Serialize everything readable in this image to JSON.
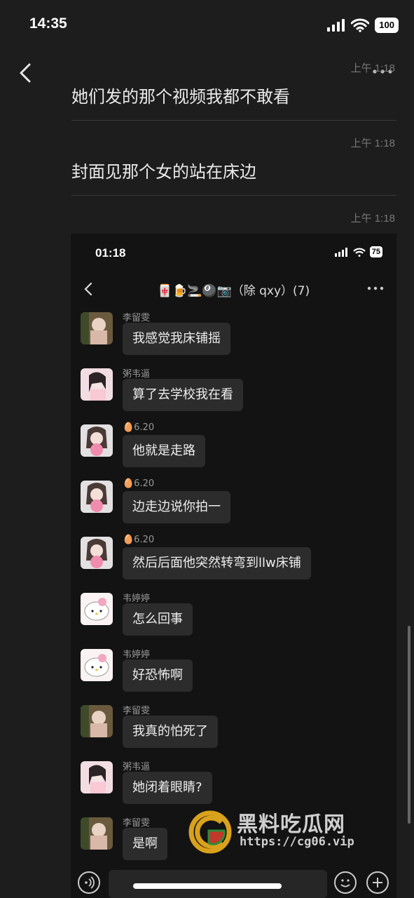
{
  "status_bar": {
    "time": "14:35",
    "battery": "100"
  },
  "messages": [
    {
      "time": "上午 1:18",
      "text": "她们发的那个视频我都不敢看"
    },
    {
      "time": "上午 1:18",
      "text": "封面见那个女的站在床边"
    },
    {
      "time": "上午 1:18",
      "text": ""
    }
  ],
  "embedded": {
    "status_time": "01:18",
    "battery": "75",
    "title": "🀄🍺🚬🎱📷（除 qxy）(7)",
    "chat": [
      {
        "name": "李留雯",
        "text": "我感觉我床铺摇",
        "avatar": "photo-girl-a"
      },
      {
        "name": "粥韦逼",
        "text": "算了去学校我在看",
        "avatar": "photo-girl-b"
      },
      {
        "name": "🥚6.20",
        "text": "他就是走路",
        "avatar": "photo-girl-c"
      },
      {
        "name": "🥚6.20",
        "text": "边走边说你拍一",
        "avatar": "photo-girl-c"
      },
      {
        "name": "🥚6.20",
        "text": "然后后面他突然转弯到llw床铺",
        "avatar": "photo-girl-c"
      },
      {
        "name": "韦婷婷",
        "text": "怎么回事",
        "avatar": "hello-kitty"
      },
      {
        "name": "韦婷婷",
        "text": "好恐怖啊",
        "avatar": "hello-kitty"
      },
      {
        "name": "李留雯",
        "text": "我真的怕死了",
        "avatar": "photo-girl-a"
      },
      {
        "name": "粥韦逼",
        "text": "她闭着眼睛?",
        "avatar": "photo-girl-b"
      },
      {
        "name": "李留雯",
        "text": "是啊",
        "avatar": "photo-girl-a"
      }
    ]
  },
  "watermark": {
    "title": "黑料吃瓜网",
    "url": "https://cg06.vip"
  },
  "colors": {
    "background": "#1d1d1d",
    "bubble": "#2c2c2c",
    "watermark_accent": "#d9a21c"
  }
}
